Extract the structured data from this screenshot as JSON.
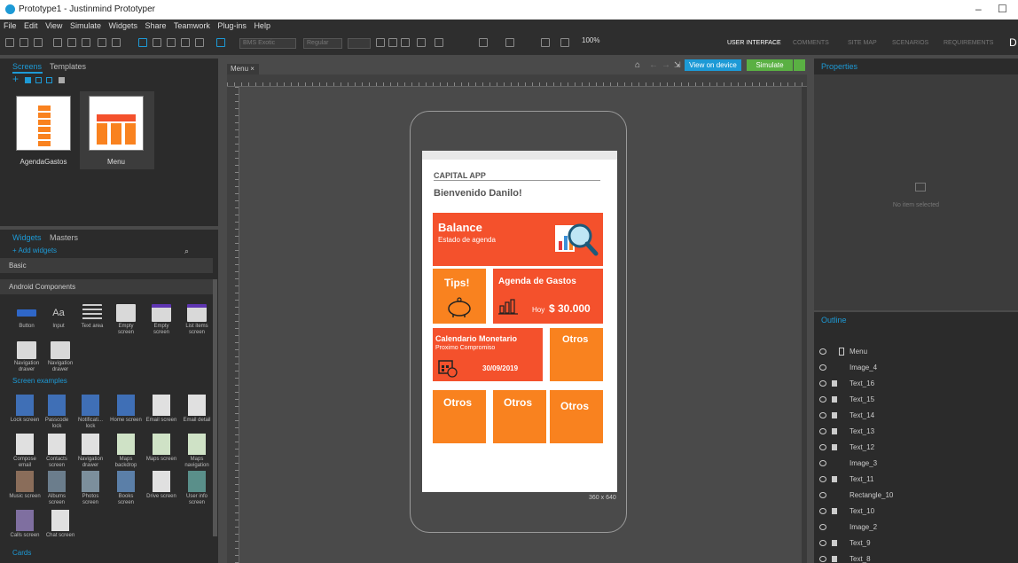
{
  "window": {
    "title": "Prototype1 - Justinmind Prototyper",
    "minimize": "–",
    "maximize": "☐"
  },
  "menu": [
    "File",
    "Edit",
    "View",
    "Simulate",
    "Widgets",
    "Share",
    "Teamwork",
    "Plug-ins",
    "Help"
  ],
  "toolbar": {
    "font_name": "BMS Exotic",
    "font_style": "Regular",
    "zoom": "100%"
  },
  "top_tabs": [
    "USER INTERFACE",
    "COMMENTS",
    "SITE MAP",
    "SCENARIOS",
    "REQUIREMENTS"
  ],
  "user_initial": "D",
  "screens_panel": {
    "tabs": [
      "Screens",
      "Templates"
    ],
    "screens": [
      {
        "name": "AgendaGastos"
      },
      {
        "name": "Menu"
      }
    ]
  },
  "widgets_panel": {
    "tabs": [
      "Widgets",
      "Masters"
    ],
    "add_label": "+ Add widgets",
    "sections": [
      "Basic",
      "Android Components"
    ],
    "android_widgets": [
      {
        "label": "Button"
      },
      {
        "label": "Input"
      },
      {
        "label": "Text area"
      },
      {
        "label": "Empty screen"
      },
      {
        "label": "Empty screen"
      },
      {
        "label": "List items screen"
      },
      {
        "label": "Navigation drawer"
      },
      {
        "label": "Navigation drawer"
      }
    ],
    "screen_examples_label": "Screen examples",
    "screen_examples": [
      {
        "label": "Lock screen"
      },
      {
        "label": "Passcode lock"
      },
      {
        "label": "Notificati... lock"
      },
      {
        "label": "Home screen"
      },
      {
        "label": "Email screen"
      },
      {
        "label": "Email detail"
      },
      {
        "label": "Compose email"
      },
      {
        "label": "Contacts screen"
      },
      {
        "label": "Navigation drawer"
      },
      {
        "label": "Maps backdrop"
      },
      {
        "label": "Maps screen"
      },
      {
        "label": "Maps navigation"
      },
      {
        "label": "Music screen"
      },
      {
        "label": "Albums screen"
      },
      {
        "label": "Photos screen"
      },
      {
        "label": "Books screen"
      },
      {
        "label": "Drive screen"
      },
      {
        "label": "User info screen"
      },
      {
        "label": "Calls screen"
      },
      {
        "label": "Chat screen"
      }
    ],
    "cards_label": "Cards"
  },
  "canvas": {
    "tab_label": "Menu ×",
    "view_on_device": "View on device",
    "simulate": "Simulate",
    "size_label": "360 x 640"
  },
  "app": {
    "header": "CAPITAL APP",
    "welcome": "Bienvenido Danilo!",
    "balance_title": "Balance",
    "balance_sub": "Estado de agenda",
    "tips": "Tips!",
    "agenda_title": "Agenda de Gastos",
    "hoy": "Hoy",
    "amount": "$ 30.000",
    "calendar_title": "Calendario Monetario",
    "calendar_sub": "Proximo Compromiso",
    "calendar_date": "30/09/2019",
    "otros1": "Otros",
    "otros2": "Otros",
    "otros3": "Otros",
    "otros4": "Otros"
  },
  "colors": {
    "accent_red": "#f4512c",
    "accent_orange": "#f9821f",
    "simulate_green": "#5ab043",
    "device_blue": "#1d9ad6"
  },
  "properties_panel": {
    "title": "Properties",
    "empty_text": "No item selected"
  },
  "outline_panel": {
    "title": "Outline",
    "items": [
      "Menu",
      "Image_4",
      "Text_16",
      "Text_15",
      "Text_14",
      "Text_13",
      "Text_12",
      "Image_3",
      "Text_11",
      "Rectangle_10",
      "Text_10",
      "Image_2",
      "Text_9",
      "Text_8"
    ]
  }
}
